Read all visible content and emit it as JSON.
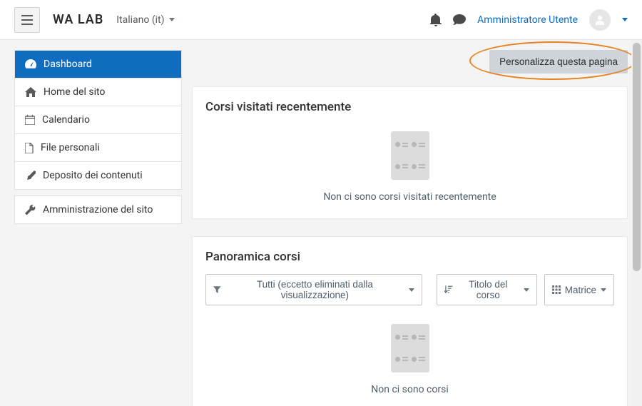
{
  "header": {
    "brand": "WA LAB",
    "language": "Italiano (it)",
    "user_name": "Amministratore Utente"
  },
  "sidebar": {
    "items": [
      {
        "label": "Dashboard",
        "icon": "tachometer",
        "active": true
      },
      {
        "label": "Home del sito",
        "icon": "home",
        "active": false
      },
      {
        "label": "Calendario",
        "icon": "calendar",
        "active": false
      },
      {
        "label": "File personali",
        "icon": "file",
        "active": false
      },
      {
        "label": "Deposito dei contenuti",
        "icon": "brush",
        "active": false
      }
    ],
    "admin_item": {
      "label": "Amministrazione del sito",
      "icon": "wrench"
    }
  },
  "main": {
    "customize_button": "Personalizza questa pagina",
    "recent_card_title": "Corsi visitati recentemente",
    "recent_empty_text": "Non ci sono corsi visitati recentemente",
    "overview_card_title": "Panoramica corsi",
    "filter_all": "Tutti (eccetto eliminati dalla visualizzazione)",
    "filter_sort": "Titolo del corso",
    "filter_view": "Matrice",
    "overview_empty_text": "Non ci sono corsi"
  }
}
